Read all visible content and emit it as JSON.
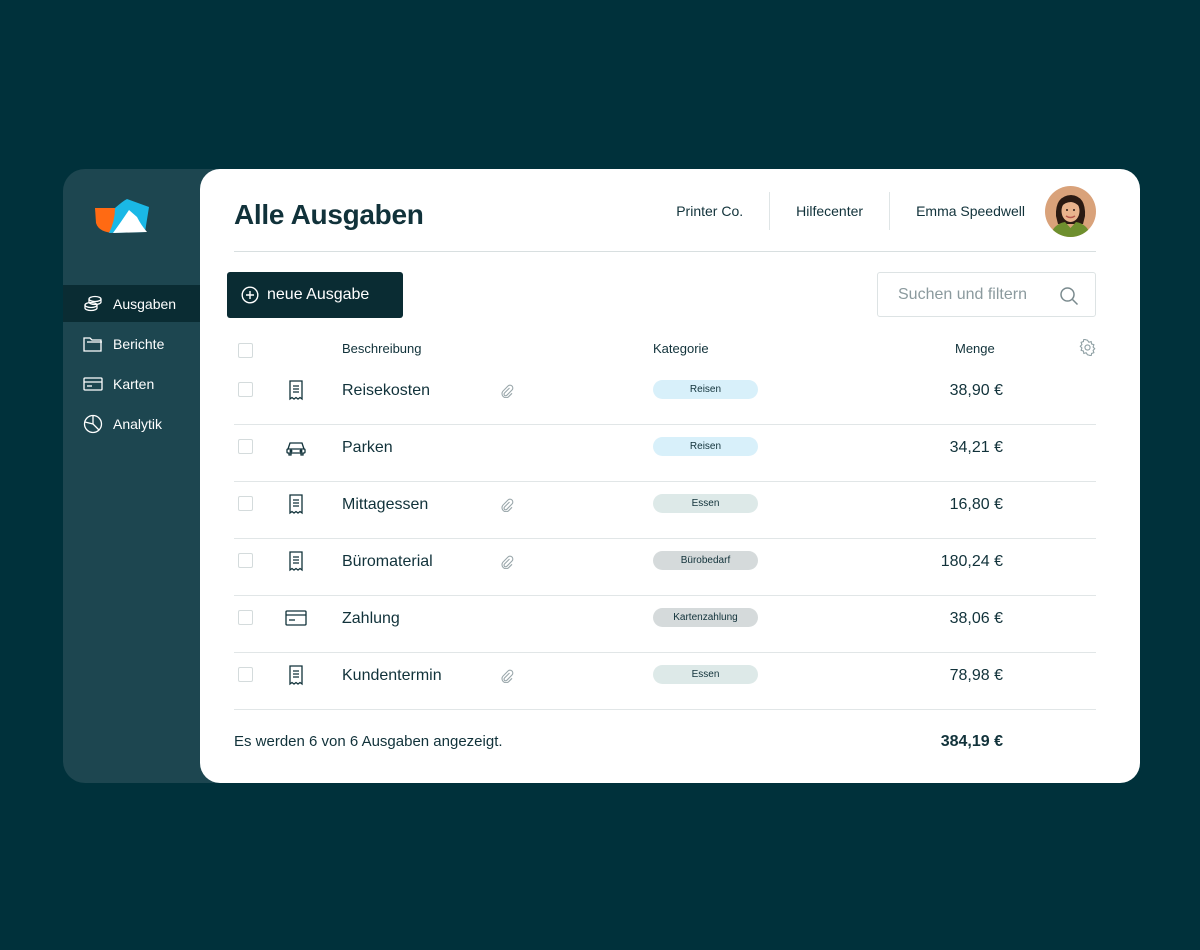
{
  "header": {
    "title": "Alle Ausgaben",
    "links": [
      "Printer Co.",
      "Hilfecenter"
    ],
    "user_name": "Emma Speedwell"
  },
  "sidebar": {
    "items": [
      {
        "label": "Ausgaben",
        "icon": "coins-icon",
        "active": true
      },
      {
        "label": "Berichte",
        "icon": "folder-icon",
        "active": false
      },
      {
        "label": "Karten",
        "icon": "credit-card-icon",
        "active": false
      },
      {
        "label": "Analytik",
        "icon": "pie-chart-icon",
        "active": false
      }
    ]
  },
  "toolbar": {
    "new_label": "neue Ausgabe",
    "search_placeholder": "Suchen und filtern"
  },
  "table": {
    "headers": {
      "description": "Beschreibung",
      "category": "Kategorie",
      "amount": "Menge"
    },
    "rows": [
      {
        "icon": "receipt-icon",
        "description": "Reisekosten",
        "attachment": true,
        "category": "Reisen",
        "category_color": "#d8f0fa",
        "amount": "38,90 €"
      },
      {
        "icon": "car-icon",
        "description": "Parken",
        "attachment": false,
        "category": "Reisen",
        "category_color": "#d8f0fa",
        "amount": "34,21 €"
      },
      {
        "icon": "receipt-icon",
        "description": "Mittagessen",
        "attachment": true,
        "category": "Essen",
        "category_color": "#dde9e8",
        "amount": "16,80 €"
      },
      {
        "icon": "receipt-icon",
        "description": "Büromaterial",
        "attachment": true,
        "category": "Bürobedarf",
        "category_color": "#d5dadb",
        "amount": "180,24 €"
      },
      {
        "icon": "card-icon",
        "description": "Zahlung",
        "attachment": false,
        "category": "Kartenzahlung",
        "category_color": "#d5dadb",
        "amount": "38,06 €"
      },
      {
        "icon": "receipt-icon",
        "description": "Kundentermin",
        "attachment": true,
        "category": "Essen",
        "category_color": "#dde9e8",
        "amount": "78,98 €"
      }
    ]
  },
  "footer": {
    "summary": "Es werden 6 von 6 Ausgaben angezeigt.",
    "total": "384,19 €"
  },
  "colors": {
    "background": "#00313b",
    "sidebar": "#1d4650",
    "primary": "#0a2c33",
    "logo_orange": "#ff6a13",
    "logo_blue": "#1ab8e6"
  }
}
